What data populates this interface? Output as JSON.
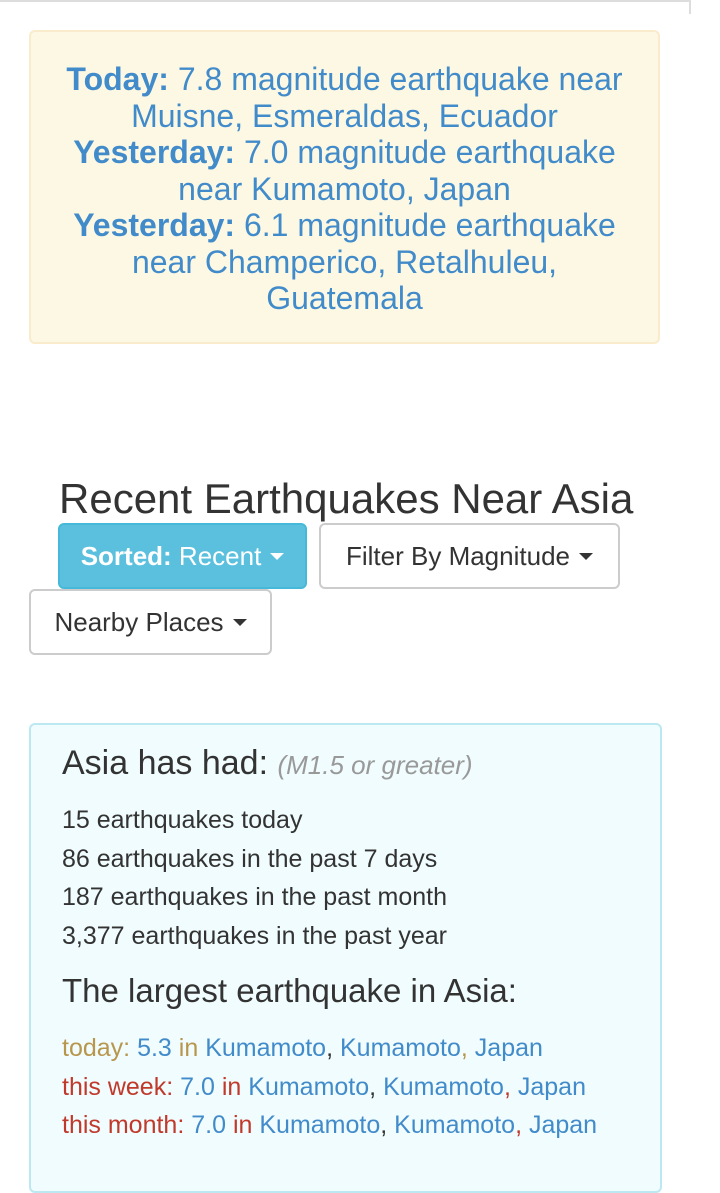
{
  "alerts": [
    {
      "label": "Today:",
      "text": "7.8 magnitude earthquake near Muisne, Esmeraldas, Ecuador"
    },
    {
      "label": "Yesterday:",
      "text": "7.0 magnitude earthquake near Kumamoto, Japan"
    },
    {
      "label": "Yesterday:",
      "text": "6.1 magnitude earthquake near Champerico, Retalhuleu, Guatemala"
    }
  ],
  "heading": "Recent Earthquakes Near Asia",
  "buttons": {
    "sorted_label": "Sorted:",
    "sorted_value": "Recent",
    "filter_label": "Filter By Magnitude",
    "nearby_label": "Nearby Places"
  },
  "stats": {
    "title": "Asia has had:",
    "note": "(M1.5 or greater)",
    "items": [
      "15 earthquakes today",
      "86 earthquakes in the past 7 days",
      "187 earthquakes in the past month",
      "3,377 earthquakes in the past year"
    ]
  },
  "largest": {
    "title": "The largest earthquake in Asia:",
    "rows": [
      {
        "period": "today:",
        "magnitude": "5.3",
        "in": "in",
        "place1": "Kumamoto",
        "place2": "Kumamoto",
        "country": "Japan"
      },
      {
        "period": "this week:",
        "magnitude": "7.0",
        "in": "in",
        "place1": "Kumamoto",
        "place2": "Kumamoto",
        "country": "Japan"
      },
      {
        "period": "this month:",
        "magnitude": "7.0",
        "in": "in",
        "place1": "Kumamoto",
        "place2": "Kumamoto",
        "country": "Japan"
      }
    ]
  },
  "colors": {
    "link": "#428bca",
    "alert_bg": "#fcf8e3",
    "info_bg": "#f0fcfd",
    "sorted_btn": "#5bc0de",
    "today_label": "#b8974d",
    "week_month_label": "#c0392b"
  },
  "icons": [
    "caret-down-icon"
  ]
}
